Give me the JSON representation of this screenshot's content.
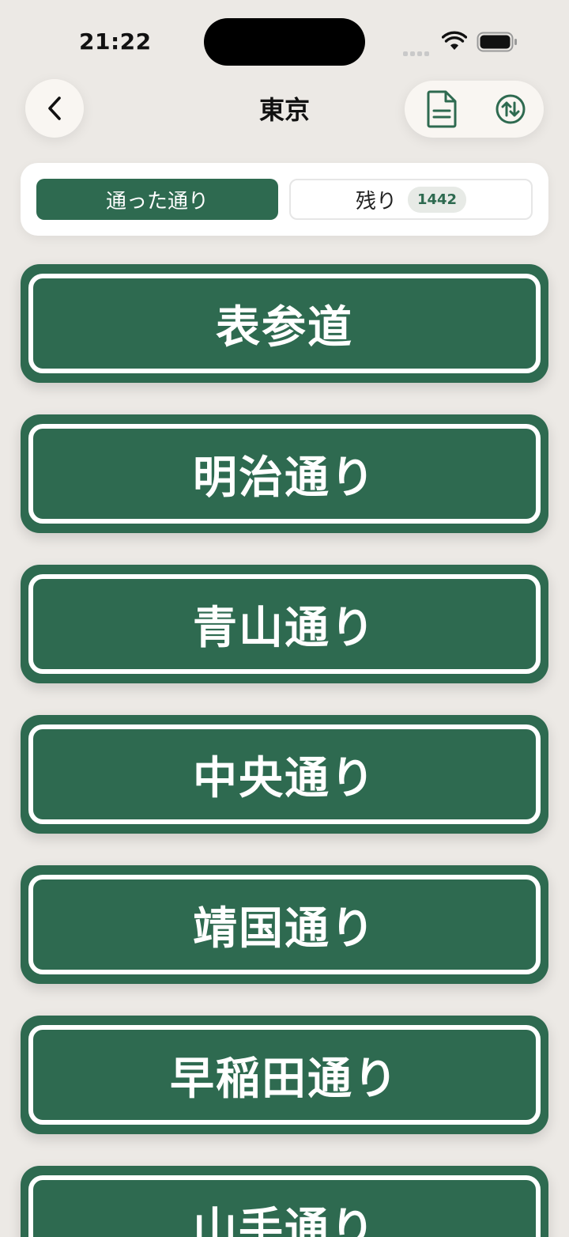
{
  "status_bar": {
    "time": "21:22"
  },
  "nav": {
    "title": "東京"
  },
  "segments": {
    "left_label": "通った通り",
    "right_label": "残り",
    "remaining_count": "1442"
  },
  "streets": [
    {
      "name": "表参道"
    },
    {
      "name": "明治通り"
    },
    {
      "name": "青山通り"
    },
    {
      "name": "中央通り"
    },
    {
      "name": "靖国通り"
    },
    {
      "name": "早稲田通り"
    },
    {
      "name": "山手通り"
    }
  ],
  "colors": {
    "accent": "#2E6A50",
    "background": "#ECE9E5",
    "card": "#FFFFFF"
  }
}
